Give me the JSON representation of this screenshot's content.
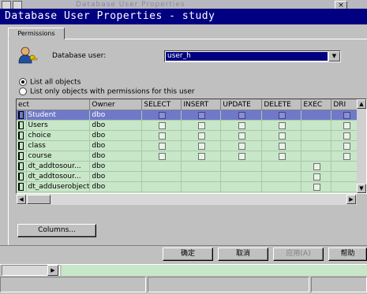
{
  "background_window": {
    "title": "Database User Properties",
    "close_glyph": "×"
  },
  "dialog": {
    "title": "Database User Properties - study",
    "tab": "Permissions",
    "database_user_label": "Database user:",
    "database_user_value": "user_h",
    "radio_all": "List all objects",
    "radio_some": "List only objects with permissions for this user",
    "grid": {
      "columns": [
        "ect",
        "Owner",
        "SELECT",
        "INSERT",
        "UPDATE",
        "DELETE",
        "EXEC",
        "DRI"
      ],
      "rows": [
        {
          "name": "Student",
          "owner": "dbo",
          "selected": true,
          "kind": "table"
        },
        {
          "name": "Users",
          "owner": "dbo",
          "selected": false,
          "kind": "table"
        },
        {
          "name": "choice",
          "owner": "dbo",
          "selected": false,
          "kind": "table"
        },
        {
          "name": "class",
          "owner": "dbo",
          "selected": false,
          "kind": "table"
        },
        {
          "name": "course",
          "owner": "dbo",
          "selected": false,
          "kind": "table"
        },
        {
          "name": "dt_addtosour...",
          "owner": "dbo",
          "selected": false,
          "kind": "proc"
        },
        {
          "name": "dt_addtosour...",
          "owner": "dbo",
          "selected": false,
          "kind": "proc"
        },
        {
          "name": "dt_adduserobject",
          "owner": "dbo",
          "selected": false,
          "kind": "proc"
        }
      ]
    },
    "columns_button": "Columns...",
    "ok_button": "确定",
    "cancel_button": "取消",
    "apply_button": "应用(A)",
    "help_button": "帮助"
  },
  "colors": {
    "title_bar": "#000080",
    "grid_bg": "#c8e6c8",
    "selected_row": "#6f79c8"
  }
}
